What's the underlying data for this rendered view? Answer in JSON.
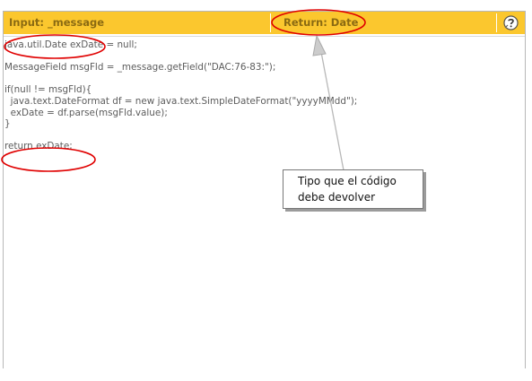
{
  "header": {
    "input_label": "Input: _message",
    "return_label": "Return: Date",
    "help_icon": "help-icon"
  },
  "code_lines": [
    "java.util.Date exDate = null;",
    "",
    "MessageField msgFld = _message.getField(\"DAC:76-83:\");",
    "",
    "if(null != msgFld){",
    "  java.text.DateFormat df = new java.text.SimpleDateFormat(\"yyyyMMdd\");",
    "  exDate = df.parse(msgFld.value);",
    "}",
    "",
    "return exDate;"
  ],
  "annotation": {
    "line1": "Tipo que el código",
    "line2": "debe devolver"
  },
  "colors": {
    "header_bg": "#fbc72e",
    "header_text": "#8a6a12",
    "highlight_ellipse": "#e00000"
  }
}
